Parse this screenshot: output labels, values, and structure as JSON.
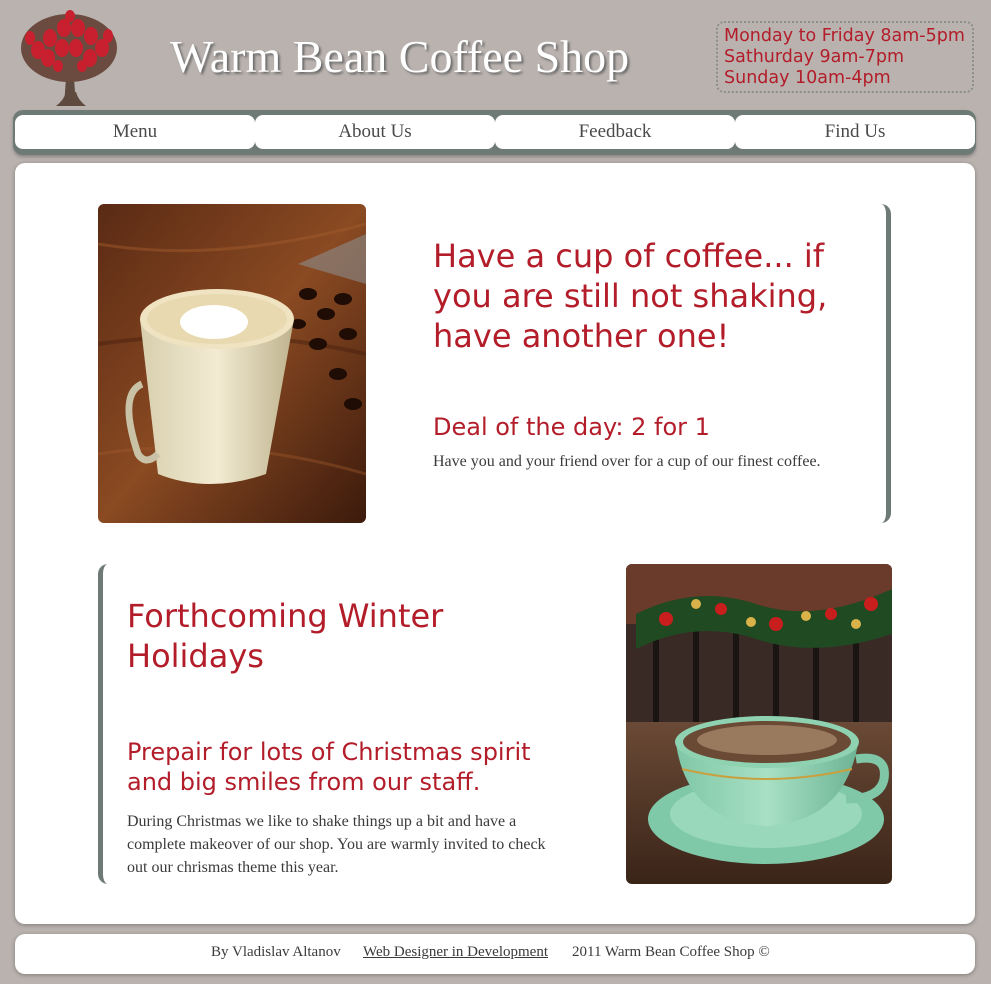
{
  "header": {
    "title": "Warm Bean Coffee Shop",
    "hours": [
      "Monday to Friday 8am-5pm",
      "Sathurday 9am-7pm",
      "Sunday 10am-4pm"
    ],
    "logo_icon": "tree-logo-icon"
  },
  "nav": {
    "items": [
      {
        "label": "Menu"
      },
      {
        "label": "About Us"
      },
      {
        "label": "Feedback"
      },
      {
        "label": "Find Us"
      }
    ]
  },
  "feature1": {
    "heading": "Have a cup of coffee... if you are still not shaking, have another one!",
    "subheading": "Deal of the day: 2 for 1",
    "text": "Have you and your friend over for a cup of our finest coffee."
  },
  "feature2": {
    "heading": "Forthcoming Winter Holidays",
    "subheading": "Prepair for lots of Christmas spirit and big smiles from our staff.",
    "text": "During Christmas we like to shake things up a bit and have a complete makeover of our shop. You are warmly invited to check out our chrismas theme this year."
  },
  "footer": {
    "author": "By Vladislav Altanov",
    "link": "Web Designer in Development",
    "copyright": "2011 Warm Bean Coffee Shop ©"
  },
  "colors": {
    "background": "#b9b2ae",
    "accent_red": "#b31d2a",
    "nav_gray": "#6e7a76"
  }
}
